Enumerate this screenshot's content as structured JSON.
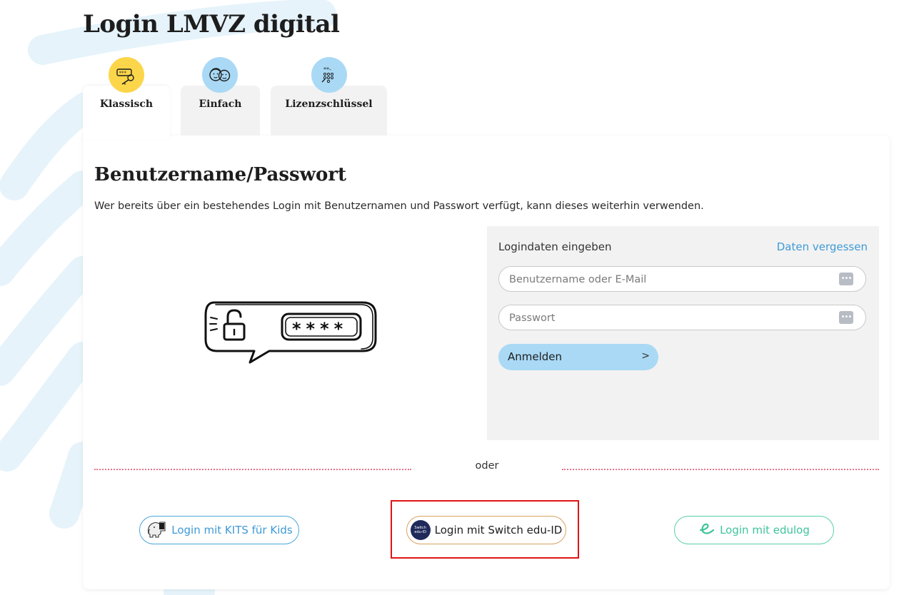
{
  "page": {
    "title": "Login LMVZ digital"
  },
  "tabs": [
    {
      "label": "Klassisch",
      "icon": "key-password-icon",
      "icon_bg": "#fcd64a",
      "active": true
    },
    {
      "label": "Einfach",
      "icon": "faces-icon",
      "icon_bg": "#a9d9f5",
      "active": false
    },
    {
      "label": "Lizenzschlüssel",
      "icon": "license-key-icon",
      "icon_bg": "#a9d9f5",
      "active": false
    }
  ],
  "section": {
    "title": "Benutzername/Passwort",
    "description": "Wer bereits über ein bestehendes Login mit Benutzernamen und Passwort verfügt, kann dieses weiterhin verwenden.",
    "illustration_icon": "speech-bubble-lock-password-icon"
  },
  "login_form": {
    "heading": "Logindaten eingeben",
    "forgot_link": "Daten vergessen",
    "username_placeholder": "Benutzername oder E-Mail",
    "password_placeholder": "Passwort",
    "submit_label": "Anmelden",
    "submit_chevron": ">"
  },
  "divider": {
    "text": "oder"
  },
  "alt_logins": [
    {
      "label": "Login mit KITS für Kids",
      "icon": "kits-elephant-icon",
      "color": "#3f9ad6"
    },
    {
      "label": "Login mit Switch edu-ID",
      "icon": "switch-edu-id-icon",
      "badge_text": "Switch edu-ID",
      "color": "#1d1d1d",
      "highlighted": true
    },
    {
      "label": "Login mit edulog",
      "icon": "edulog-icon",
      "color": "#3fc49b"
    }
  ],
  "colors": {
    "accent_blue": "#a9d9f5",
    "link_blue": "#3f9ad6",
    "accent_yellow": "#fcd64a",
    "divider_pink": "#e3748a",
    "highlight_red": "#e01414"
  }
}
